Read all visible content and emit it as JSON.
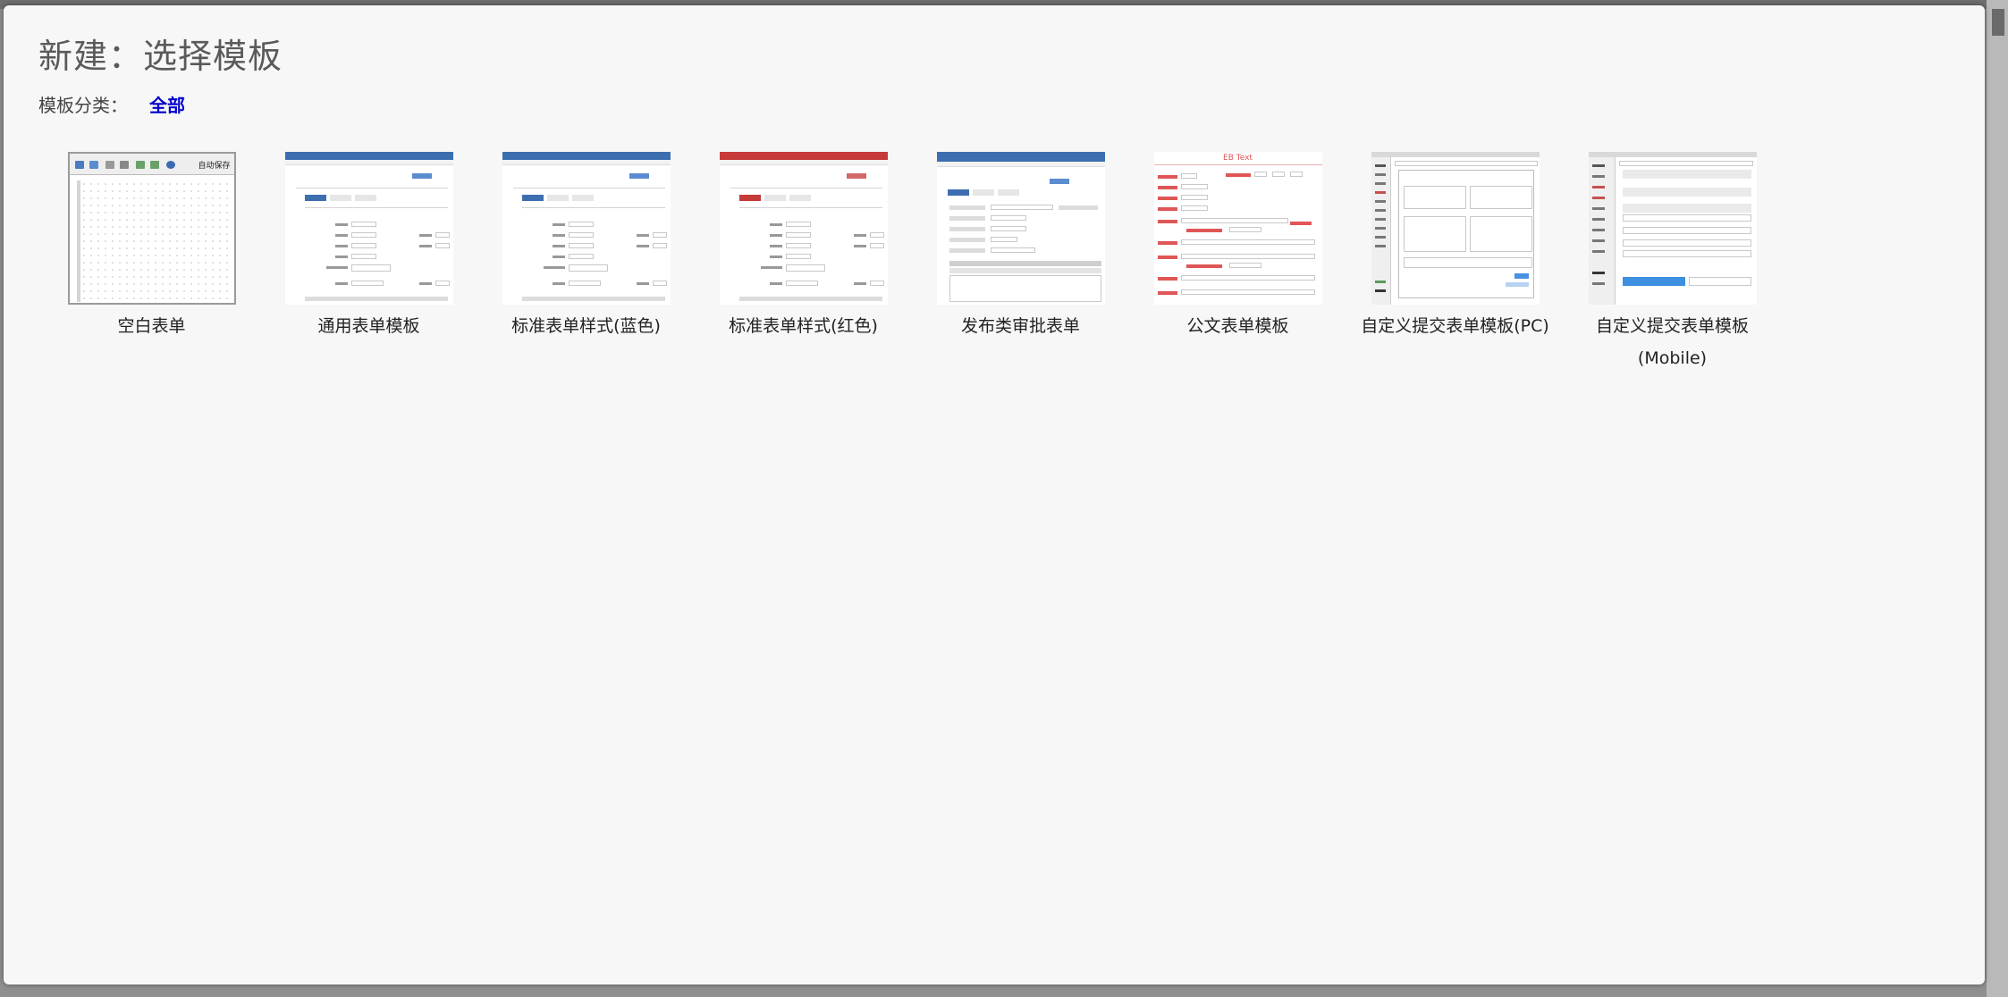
{
  "dialog": {
    "title": "新建：选择模板",
    "category_label": "模板分类：",
    "category_all": "全部"
  },
  "templates": [
    {
      "name": "空白表单",
      "thumb": "blank-form",
      "toolbar_label": "自动保存"
    },
    {
      "name": "通用表单模板",
      "thumb": "general-form",
      "accent": "#3d6fb0"
    },
    {
      "name": "标准表单样式(蓝色)",
      "thumb": "standard-blue",
      "accent": "#3d6fb0"
    },
    {
      "name": "标准表单样式(红色)",
      "thumb": "standard-red",
      "accent": "#c63a3a"
    },
    {
      "name": "发布类审批表单",
      "thumb": "publish-approval",
      "accent": "#3d6fb0"
    },
    {
      "name": "公文表单模板",
      "thumb": "official-document",
      "accent": "#e05656",
      "thumb_title": "EB Text"
    },
    {
      "name": "自定义提交表单模板(PC)",
      "thumb": "custom-submit-pc"
    },
    {
      "name": "自定义提交表单模板 (Mobile)",
      "thumb": "custom-submit-mobile",
      "accent": "#3d8fe0"
    }
  ]
}
